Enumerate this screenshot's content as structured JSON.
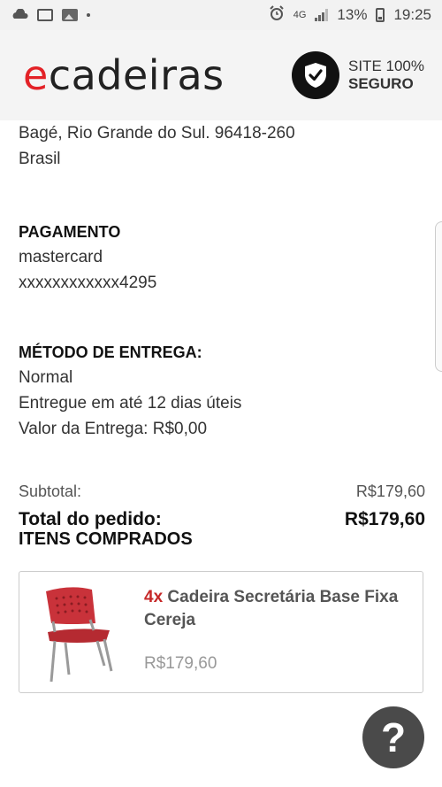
{
  "status_bar": {
    "battery_percent": "13%",
    "time": "19:25",
    "network": "4G"
  },
  "header": {
    "logo_first": "e",
    "logo_rest": "cadeiras",
    "secure_line1": "SITE 100%",
    "secure_line2": "SEGURO"
  },
  "address": {
    "city_line": "Bagé, Rio Grande do Sul. 96418-260",
    "country": "Brasil"
  },
  "payment": {
    "title": "PAGAMENTO",
    "method": "mastercard",
    "card_number": "xxxxxxxxxxxx4295"
  },
  "delivery": {
    "title": "MÉTODO DE ENTREGA:",
    "type": "Normal",
    "eta": "Entregue em até 12 dias úteis",
    "fee": "Valor da Entrega: R$0,00"
  },
  "summary": {
    "subtotal_label": "Subtotal:",
    "subtotal_value": "R$179,60",
    "total_label": "Total do pedido:",
    "total_value": "R$179,60"
  },
  "items": {
    "title": "ITENS COMPRADOS",
    "list": [
      {
        "qty": "4x",
        "name": "Cadeira Secretária Base Fixa Cereja",
        "price": "R$179,60"
      }
    ]
  },
  "help": {
    "label": "?"
  },
  "colors": {
    "brand_red": "#e32227",
    "dark": "#111111",
    "help_bg": "#4a4a4a"
  }
}
